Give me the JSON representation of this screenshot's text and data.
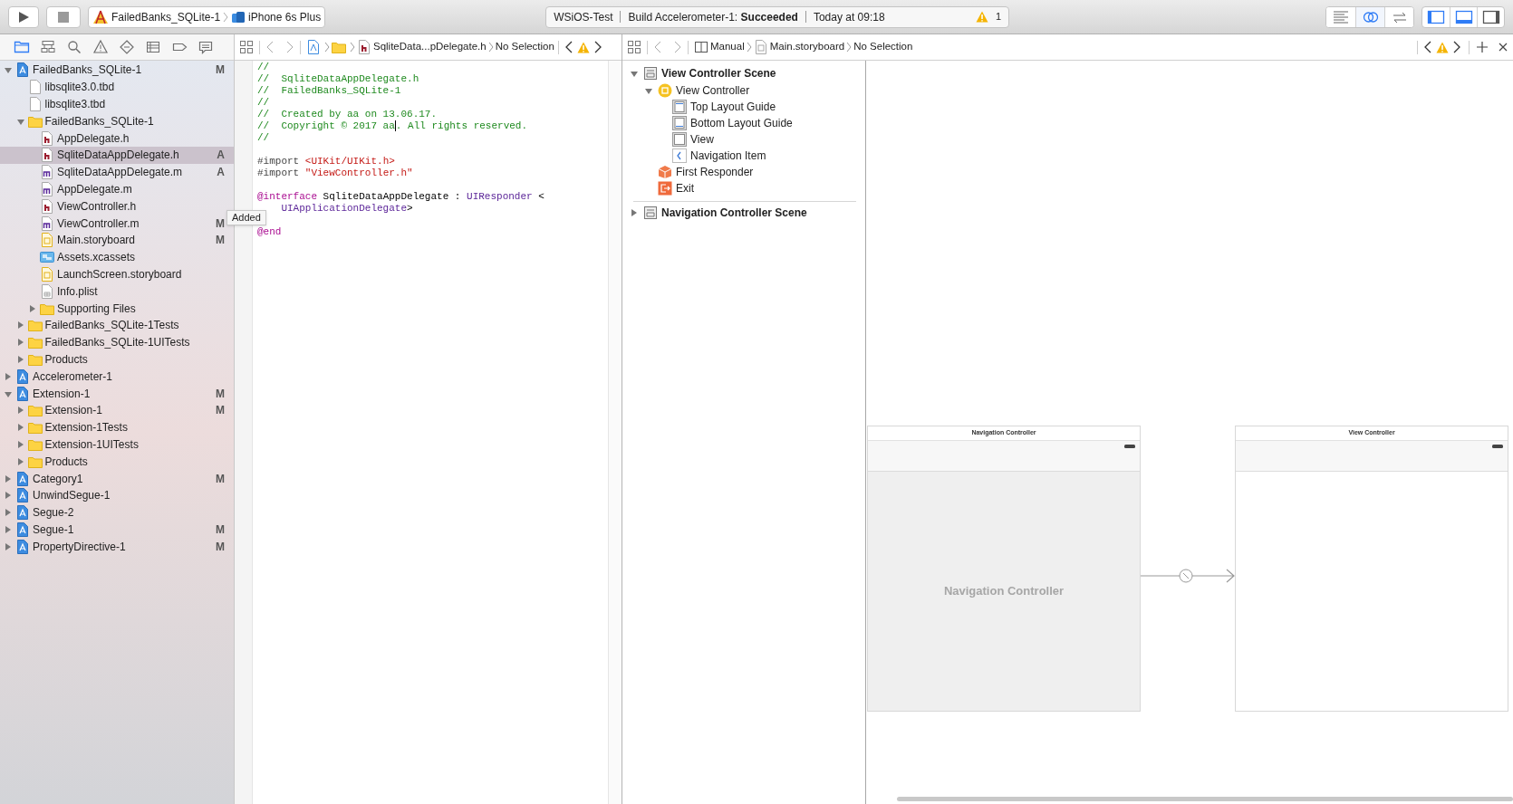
{
  "toolbar": {
    "scheme": {
      "project": "FailedBanks_SQLite-1",
      "device": "iPhone 6s Plus"
    },
    "activity": {
      "project": "WSiOS-Test",
      "status": "Build Accelerometer-1: **Succeeded**",
      "time": "Today at 09:18",
      "warning_count": "1"
    },
    "editor_modes": [
      {
        "kind": "standard",
        "selected": false
      },
      {
        "kind": "assistant",
        "selected": true
      },
      {
        "kind": "version",
        "selected": false
      }
    ],
    "panels": [
      {
        "kind": "navigator",
        "on": true
      },
      {
        "kind": "debug",
        "on": true
      },
      {
        "kind": "utilities",
        "on": false
      }
    ]
  },
  "navigator": {
    "tabs": [
      {
        "kind": "project",
        "selected": true
      },
      {
        "kind": "symbol",
        "selected": false
      },
      {
        "kind": "find",
        "selected": false
      },
      {
        "kind": "issue",
        "selected": false
      },
      {
        "kind": "test",
        "selected": false
      },
      {
        "kind": "debug",
        "selected": false
      },
      {
        "kind": "breakpoint",
        "selected": false
      },
      {
        "kind": "report",
        "selected": false
      }
    ],
    "tree": [
      {
        "label": "FailedBanks_SQLite-1",
        "kind": "project",
        "expanded": true,
        "selected": false,
        "badge": "M",
        "children": [
          {
            "label": "libsqlite3.0.tbd",
            "kind": "file",
            "selected": false
          },
          {
            "label": "libsqlite3.tbd",
            "kind": "file",
            "selected": false
          },
          {
            "label": "FailedBanks_SQLite-1",
            "kind": "folder",
            "expanded": true,
            "selected": false,
            "children": [
              {
                "label": "AppDelegate.h",
                "kind": "header",
                "selected": false
              },
              {
                "label": "SqliteDataAppDelegate.h",
                "kind": "header",
                "selected": true,
                "badge": "A"
              },
              {
                "label": "SqliteDataAppDelegate.m",
                "kind": "source",
                "selected": false,
                "badge": "A"
              },
              {
                "label": "AppDelegate.m",
                "kind": "source",
                "selected": false
              },
              {
                "label": "ViewController.h",
                "kind": "header",
                "selected": false
              },
              {
                "label": "ViewController.m",
                "kind": "source",
                "selected": false,
                "badge": "M"
              },
              {
                "label": "Main.storyboard",
                "kind": "storyboard",
                "selected": false,
                "badge": "M"
              },
              {
                "label": "Assets.xcassets",
                "kind": "assets",
                "selected": false
              },
              {
                "label": "LaunchScreen.storyboard",
                "kind": "storyboard",
                "selected": false
              },
              {
                "label": "Info.plist",
                "kind": "plist",
                "selected": false
              },
              {
                "label": "Supporting Files",
                "kind": "folder",
                "expanded": false,
                "selected": false
              }
            ]
          },
          {
            "label": "FailedBanks_SQLite-1Tests",
            "kind": "folder",
            "expanded": false,
            "selected": false
          },
          {
            "label": "FailedBanks_SQLite-1UITests",
            "kind": "folder",
            "expanded": false,
            "selected": false
          },
          {
            "label": "Products",
            "kind": "folder",
            "expanded": false,
            "selected": false
          }
        ]
      },
      {
        "label": "Accelerometer-1",
        "kind": "project",
        "expanded": false,
        "selected": false
      },
      {
        "label": "Extension-1",
        "kind": "project",
        "expanded": true,
        "selected": false,
        "badge": "M",
        "children": [
          {
            "label": "Extension-1",
            "kind": "folder",
            "expanded": false,
            "selected": false,
            "badge": "M"
          },
          {
            "label": "Extension-1Tests",
            "kind": "folder",
            "expanded": false,
            "selected": false
          },
          {
            "label": "Extension-1UITests",
            "kind": "folder",
            "expanded": false,
            "selected": false
          },
          {
            "label": "Products",
            "kind": "folder",
            "expanded": false,
            "selected": false
          }
        ]
      },
      {
        "label": "Category1",
        "kind": "project",
        "expanded": false,
        "selected": false,
        "badge": "M"
      },
      {
        "label": "UnwindSegue-1",
        "kind": "project",
        "expanded": false,
        "selected": false
      },
      {
        "label": "Segue-2",
        "kind": "project",
        "expanded": false,
        "selected": false
      },
      {
        "label": "Segue-1",
        "kind": "project",
        "expanded": false,
        "selected": false,
        "badge": "M"
      },
      {
        "label": "PropertyDirective-1",
        "kind": "project",
        "expanded": false,
        "selected": false,
        "badge": "M"
      }
    ],
    "tooltip": "Added"
  },
  "editor": {
    "jump_bar": [
      {
        "kind": "project"
      },
      {
        "kind": "folder"
      },
      {
        "kind": "header",
        "label": "SqliteData...pDelegate.h"
      },
      {
        "kind": "text",
        "label": "No Selection"
      }
    ],
    "lines": [
      {
        "kind": "code",
        "tokens": [
          {
            "kind": "comment",
            "text": "//"
          }
        ]
      },
      {
        "kind": "code",
        "tokens": [
          {
            "kind": "comment",
            "text": "//  SqliteDataAppDelegate.h"
          }
        ]
      },
      {
        "kind": "code",
        "tokens": [
          {
            "kind": "comment",
            "text": "//  FailedBanks_SQLite-1"
          }
        ]
      },
      {
        "kind": "code",
        "tokens": [
          {
            "kind": "comment",
            "text": "//"
          }
        ]
      },
      {
        "kind": "code",
        "tokens": [
          {
            "kind": "comment",
            "text": "//  Created by aa on 13.06.17."
          }
        ]
      },
      {
        "kind": "code",
        "tokens": [
          {
            "kind": "comment",
            "text": "//  Copyright © 2017 aa",
            "caret_after": true
          },
          {
            "kind": "comment",
            "text": ". All rights reserved."
          }
        ]
      },
      {
        "kind": "code",
        "tokens": [
          {
            "kind": "comment",
            "text": "//"
          }
        ]
      },
      {
        "kind": "code",
        "gap_before": true,
        "tokens": [
          {
            "kind": "directive",
            "text": "#import "
          },
          {
            "kind": "string",
            "text": "<UIKit/UIKit.h>"
          }
        ]
      },
      {
        "kind": "code",
        "tokens": [
          {
            "kind": "directive",
            "text": "#import "
          },
          {
            "kind": "string",
            "text": "\"ViewController.h\""
          }
        ]
      },
      {
        "kind": "code",
        "gap_before": true,
        "tokens": [
          {
            "kind": "keyword",
            "text": "@interface"
          },
          {
            "kind": "plain",
            "text": " SqliteDataAppDelegate : "
          },
          {
            "kind": "type",
            "text": "UIResponder"
          },
          {
            "kind": "plain",
            "text": " <"
          }
        ]
      },
      {
        "kind": "code",
        "tokens": [
          {
            "kind": "type",
            "text": "    UIApplicationDelegate"
          },
          {
            "kind": "plain",
            "text": ">"
          }
        ]
      },
      {
        "kind": "code",
        "gap_before": true,
        "tokens": [
          {
            "kind": "keyword",
            "text": "@end"
          }
        ]
      }
    ]
  },
  "assistant": {
    "jump_bar": [
      {
        "kind": "split",
        "label": "Manual"
      },
      {
        "kind": "storyboard",
        "label": "Main.storyboard"
      },
      {
        "kind": "text",
        "label": "No Selection"
      }
    ],
    "outline": [
      {
        "label": "View Controller Scene",
        "kind": "scene",
        "expanded": true,
        "children": [
          {
            "label": "View Controller",
            "kind": "controller",
            "expanded": true,
            "children": [
              {
                "label": "Top Layout Guide",
                "kind": "top_guide"
              },
              {
                "label": "Bottom Layout Guide",
                "kind": "bottom_guide"
              },
              {
                "label": "View",
                "kind": "view"
              },
              {
                "label": "Navigation Item",
                "kind": "nav_item"
              }
            ]
          },
          {
            "label": "First Responder",
            "kind": "responder"
          },
          {
            "label": "Exit",
            "kind": "exit"
          }
        ]
      },
      {
        "label": "Navigation Controller Scene",
        "kind": "scene",
        "expanded": false
      }
    ],
    "scenes": [
      {
        "kind": "navigation",
        "title": "Navigation Controller",
        "placeholder": "Navigation Controller"
      },
      {
        "kind": "view",
        "title": "View Controller"
      }
    ]
  }
}
